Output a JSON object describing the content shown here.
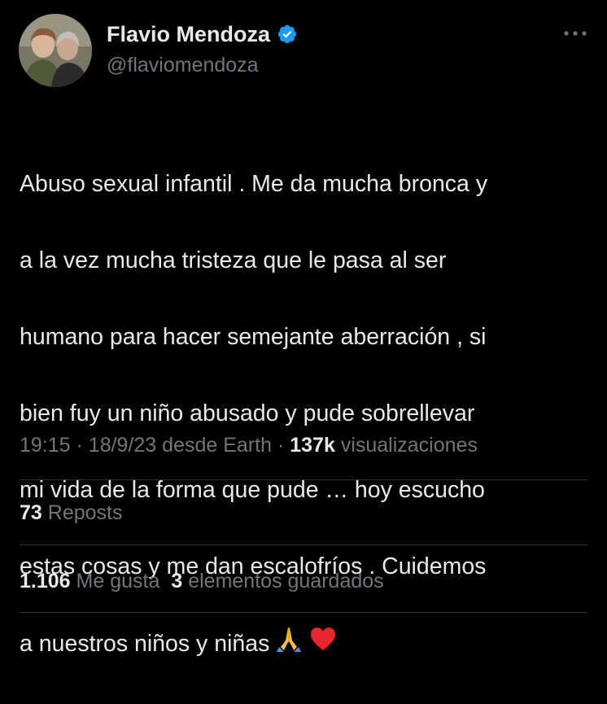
{
  "author": {
    "display_name": "Flavio Mendoza",
    "handle": "@flaviomendoza",
    "verified_color": "#1d9bf0",
    "avatar_icon": "profile-photo"
  },
  "more_icon": "ellipsis-icon",
  "tweet": {
    "lines": [
      "Abuso sexual infantil . Me da mucha bronca y",
      "a la vez mucha tristeza que le pasa al ser",
      "humano para hacer semejante aberración , si",
      "bien fuy un niño abusado y pude sobrellevar",
      "mi vida de la forma que pude … hoy escucho",
      "estas cosas y me dan escalofríos . Cuidemos",
      "a nuestros niños y niñas"
    ],
    "emojis": [
      "🙏",
      "❤️"
    ]
  },
  "meta": {
    "time": "19:15",
    "date": "18/9/23",
    "source": "desde Earth",
    "views_count": "137k",
    "views_label": "visualizaciones",
    "separator": "·"
  },
  "stats": {
    "reposts_count": "73",
    "reposts_label": "Reposts",
    "likes_count": "1.106",
    "likes_label": "Me gusta",
    "bookmarks_count": "3",
    "bookmarks_label": "elementos guardados"
  },
  "colors": {
    "background": "#000000",
    "text": "#e7e9ea",
    "secondary": "#71767b",
    "divider": "#2f3336"
  }
}
